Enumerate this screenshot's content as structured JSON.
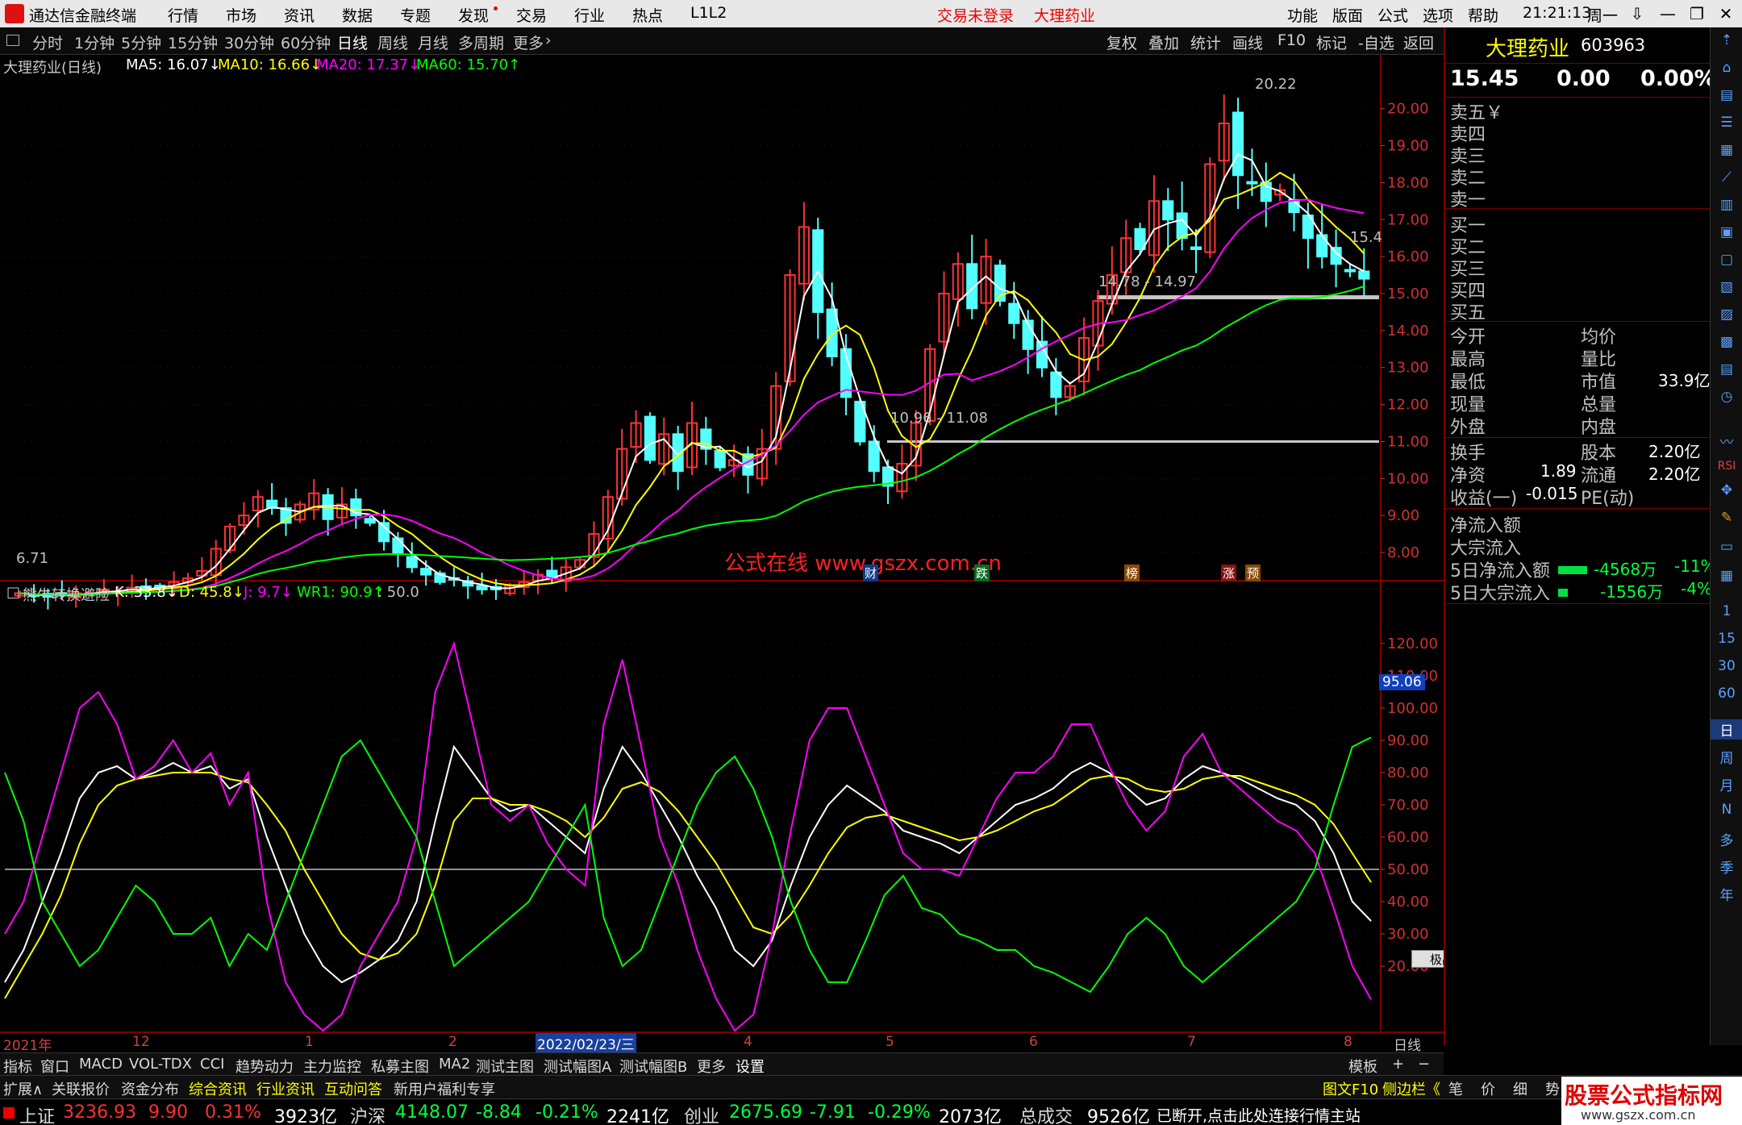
{
  "titlebar": {
    "app_title": "通达信金融终端",
    "menus": [
      "行情",
      "市场",
      "资讯",
      "数据",
      "专题",
      "发现",
      "交易",
      "行业",
      "热点",
      "L1L2"
    ],
    "alert_login": "交易未登录",
    "alert_stock": "大理药业",
    "right_menus": [
      "功能",
      "版面",
      "公式",
      "选项",
      "帮助"
    ],
    "clock": "21:21:13",
    "weekday": "周一",
    "win_buttons": [
      "⇩",
      "—",
      "❐",
      "✕"
    ]
  },
  "toolbar": {
    "periods": [
      "分时",
      "1分钟",
      "5分钟",
      "15分钟",
      "30分钟",
      "60分钟",
      "日线",
      "周线",
      "月线",
      "多周期",
      "更多"
    ],
    "active_period": "日线",
    "right_items": [
      "复权",
      "叠加",
      "统计",
      "画线",
      "F10",
      "标记",
      "-自选",
      "返回"
    ]
  },
  "main_chart": {
    "title": "大理药业(日线)",
    "ma_labels": [
      {
        "text": "MA5: 16.07↓",
        "color": "#ffffff"
      },
      {
        "text": "MA10: 16.66↓",
        "color": "#ffff00"
      },
      {
        "text": "MA20: 17.37↓",
        "color": "#ff00ff"
      },
      {
        "text": "MA60: 15.70↑",
        "color": "#00ff00"
      }
    ],
    "annotations": {
      "high": "20.22",
      "low": "6.71",
      "last": "15.4",
      "range1": "14.78 - 14.97",
      "range2": "10.96 - 11.08"
    },
    "watermark": "公式在线  www.gszx.com.cn",
    "event_markers": [
      "财",
      "跌",
      "榜",
      "涨",
      "预"
    ]
  },
  "indicator": {
    "title": "熊牛转换避险",
    "labels": [
      {
        "text": "K: 33.8↓",
        "color": "#ffffff"
      },
      {
        "text": "D: 45.8↓",
        "color": "#ffff00"
      },
      {
        "text": "J: 9.7↓",
        "color": "#ff00ff"
      },
      {
        "text": "WR1: 90.9↑",
        "color": "#00ff00"
      },
      {
        "text": ": 50.0",
        "color": "#c0c0c0"
      }
    ],
    "cursor_value": "95.06",
    "mini_label": "极品五笔"
  },
  "date_axis": {
    "labels": [
      "2021年",
      "12",
      "1",
      "2",
      "2022/02/23/三",
      "4",
      "5",
      "6",
      "7",
      "8"
    ],
    "period": "日线"
  },
  "chart_data": [
    {
      "type": "candlestick",
      "title": "大理药业(日线)",
      "ylim": [
        7.5,
        20.8
      ],
      "yticks": [
        8.0,
        9.0,
        10.0,
        11.0,
        12.0,
        13.0,
        14.0,
        15.0,
        16.0,
        17.0,
        18.0,
        19.0,
        20.0
      ],
      "close": [
        6.9,
        6.85,
        6.8,
        6.85,
        6.9,
        6.9,
        7.0,
        6.95,
        7.05,
        7.0,
        7.1,
        7.2,
        7.3,
        7.5,
        8.1,
        8.7,
        9.0,
        9.5,
        9.2,
        8.8,
        9.3,
        9.6,
        8.9,
        9.3,
        9.0,
        8.8,
        8.3,
        8.0,
        7.6,
        7.4,
        7.2,
        7.3,
        7.1,
        7.0,
        7.0,
        7.1,
        7.2,
        7.4,
        7.3,
        7.6,
        7.8,
        8.5,
        9.5,
        10.8,
        11.5,
        10.5,
        11.2,
        10.2,
        11.5,
        10.8,
        10.3,
        10.5,
        10.1,
        10.8,
        12.5,
        15.5,
        16.8,
        14.5,
        13.3,
        12.2,
        11.0,
        10.2,
        9.8,
        10.4,
        11.5,
        13.5,
        15.0,
        15.8,
        14.6,
        16.0,
        14.8,
        14.2,
        13.5,
        13.0,
        12.2,
        12.5,
        13.8,
        14.8,
        15.5,
        16.5,
        16.2,
        17.5,
        17.0,
        16.5,
        16.2,
        18.5,
        19.6,
        18.2,
        18.0,
        17.5,
        17.8,
        17.2,
        16.5,
        16.0,
        15.8,
        15.6,
        15.4
      ],
      "ma_last": {
        "MA5": 16.07,
        "MA10": 16.66,
        "MA20": 17.37,
        "MA60": 15.7
      },
      "hlines": [
        14.9,
        11.0
      ]
    },
    {
      "type": "line",
      "title": "熊牛转换避险",
      "ylim": [
        0,
        130
      ],
      "yticks": [
        20,
        30,
        40,
        50,
        60,
        70,
        80,
        90,
        100,
        110,
        120
      ],
      "series": [
        {
          "name": "K",
          "color": "#ffffff",
          "values": [
            15,
            25,
            40,
            55,
            72,
            80,
            82,
            78,
            80,
            83,
            80,
            82,
            75,
            78,
            60,
            45,
            30,
            20,
            15,
            18,
            22,
            28,
            40,
            65,
            88,
            80,
            72,
            68,
            70,
            65,
            60,
            55,
            75,
            88,
            80,
            70,
            60,
            48,
            38,
            25,
            20,
            28,
            45,
            60,
            70,
            76,
            72,
            68,
            62,
            60,
            58,
            55,
            60,
            65,
            70,
            72,
            75,
            80,
            83,
            80,
            75,
            70,
            72,
            78,
            82,
            80,
            78,
            75,
            72,
            70,
            65,
            55,
            40,
            34
          ]
        },
        {
          "name": "D",
          "color": "#ffff00",
          "values": [
            10,
            20,
            30,
            42,
            58,
            70,
            76,
            78,
            79,
            80,
            80,
            80,
            78,
            77,
            70,
            62,
            50,
            40,
            30,
            24,
            22,
            24,
            30,
            45,
            65,
            72,
            72,
            70,
            70,
            68,
            65,
            60,
            66,
            75,
            77,
            74,
            68,
            60,
            52,
            42,
            32,
            30,
            36,
            45,
            55,
            63,
            66,
            67,
            65,
            63,
            61,
            59,
            60,
            62,
            65,
            68,
            70,
            74,
            78,
            79,
            78,
            75,
            74,
            75,
            78,
            79,
            79,
            77,
            75,
            73,
            70,
            64,
            55,
            46
          ]
        },
        {
          "name": "J",
          "color": "#ff00ff",
          "values": [
            30,
            40,
            60,
            80,
            100,
            105,
            95,
            78,
            82,
            90,
            80,
            86,
            70,
            80,
            40,
            15,
            5,
            0,
            5,
            20,
            30,
            40,
            60,
            105,
            120,
            95,
            70,
            65,
            70,
            58,
            50,
            45,
            95,
            115,
            88,
            60,
            45,
            25,
            10,
            0,
            5,
            30,
            62,
            90,
            100,
            100,
            85,
            70,
            55,
            50,
            50,
            48,
            60,
            72,
            80,
            80,
            85,
            95,
            95,
            82,
            70,
            62,
            68,
            85,
            92,
            80,
            75,
            70,
            65,
            62,
            55,
            38,
            20,
            9.7
          ]
        },
        {
          "name": "WR1",
          "color": "#00ff00",
          "values": [
            80,
            65,
            40,
            30,
            20,
            25,
            35,
            45,
            40,
            30,
            30,
            35,
            20,
            30,
            25,
            40,
            55,
            70,
            85,
            90,
            80,
            70,
            60,
            40,
            20,
            25,
            30,
            35,
            40,
            50,
            60,
            70,
            35,
            20,
            25,
            40,
            55,
            70,
            80,
            85,
            75,
            60,
            40,
            25,
            15,
            15,
            28,
            42,
            48,
            38,
            36,
            30,
            28,
            25,
            25,
            20,
            18,
            15,
            12,
            20,
            30,
            35,
            30,
            20,
            15,
            20,
            25,
            30,
            35,
            40,
            50,
            70,
            88,
            90.9
          ]
        }
      ],
      "hline": 50.0,
      "cursor_value": 95.06
    }
  ],
  "right_panel": {
    "stock_name": "大理药业",
    "stock_code": "603963",
    "price": "15.45",
    "change": "0.00",
    "change_pct": "0.00%",
    "sell_labels": [
      "卖五￥",
      "卖四",
      "卖三",
      "卖二",
      "卖一"
    ],
    "buy_labels": [
      "买一",
      "买二",
      "买三",
      "买四",
      "买五"
    ],
    "stats_left": [
      "今开",
      "最高",
      "最低",
      "现量",
      "外盘"
    ],
    "stats_right": [
      "均价",
      "量比",
      "市值",
      "总量",
      "内盘"
    ],
    "market_cap": "33.9亿",
    "fin": [
      {
        "l": "换手",
        "lv": "",
        "r": "股本",
        "rv": "2.20亿"
      },
      {
        "l": "净资",
        "lv": "1.89",
        "r": "流通",
        "rv": "2.20亿"
      },
      {
        "l": "收益(一)",
        "lv": "-0.015",
        "r": "PE(动)",
        "rv": ""
      }
    ],
    "flows": [
      {
        "label": "净流入额",
        "value": "",
        "pct": ""
      },
      {
        "label": "大宗流入",
        "value": "",
        "pct": ""
      },
      {
        "label": "5日净流入额",
        "value": "-4568万",
        "pct": "-11%"
      },
      {
        "label": "5日大宗流入",
        "value": "-1556万",
        "pct": "-4%"
      }
    ]
  },
  "sidebar": [
    "RSI",
    "1",
    "15",
    "30",
    "60",
    "日",
    "周",
    "月",
    "N",
    "多",
    "季",
    "年"
  ],
  "tabbar1": [
    "指标",
    "窗口",
    "MACD",
    "VOL-TDX",
    "CCI",
    "趋势动力",
    "主力监控",
    "私募主图",
    "MA2",
    "测试主图",
    "测试幅图A",
    "测试幅图B",
    "更多",
    "设置"
  ],
  "tabbar1_right": [
    "模板",
    "+",
    "−"
  ],
  "tabbar2": [
    "扩展∧",
    "关联报价",
    "资金分布",
    "综合资讯",
    "行业资讯",
    "互动问答",
    "新用户福利专享"
  ],
  "tabbar2_right": [
    "图文F10",
    "侧边栏《",
    "笔",
    "价",
    "细",
    "势"
  ],
  "statusbar": {
    "items": [
      {
        "name": "上证",
        "value": "3236.93",
        "change": "9.90",
        "pct": "0.31%",
        "vol": "3923亿"
      },
      {
        "name": "沪深",
        "value": "4148.07",
        "change": "-8.84",
        "pct": "-0.21%",
        "vol": "2241亿"
      },
      {
        "name": "创业",
        "value": "2675.69",
        "change": "-7.91",
        "pct": "-0.29%",
        "vol": "2073亿"
      }
    ],
    "total_label": "总成交",
    "total_value": "9526亿",
    "message": "已断开,点击此处连接行情主站",
    "brand": "股票公式指标网",
    "brand_url": "www.gszx.com.cn"
  }
}
